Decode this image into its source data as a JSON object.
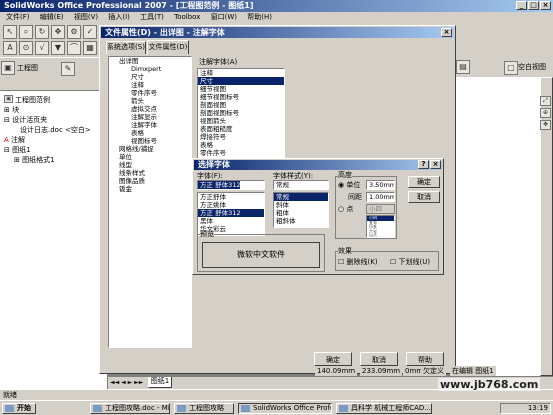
{
  "app": {
    "title": "SolidWorks Office Professional 2007 - [工程图范例 - 图纸1]"
  },
  "menu": [
    "文件(F)",
    "编辑(E)",
    "视图(V)",
    "插入(I)",
    "工具(T)",
    "Toolbox",
    "窗口(W)",
    "帮助(H)"
  ],
  "toolbar": {
    "labels": [
      "工程图",
      "草图",
      "注解",
      "空白视图"
    ]
  },
  "tree": {
    "items": [
      "工程图范例",
      "块",
      "设计活页夹",
      "设计日志.doc <空白>",
      "注解",
      "图纸1",
      "图纸格式1"
    ]
  },
  "doc_props": {
    "title": "文件属性(D) - 出详图 - 注解字体",
    "tabs": [
      "系统选项(S)",
      "文件属性(D)"
    ],
    "left_items": [
      "出详图",
      "Dimxpert",
      "尺寸",
      "注释",
      "零件序号",
      "箭头",
      "虚拟交点",
      "注解显示",
      "注解字体",
      "表格",
      "视图标号",
      "网格线/捕捉",
      "单位",
      "线型",
      "线条样式",
      "图像品质",
      "钣金"
    ],
    "font_label": "注解字体(A)",
    "font_items": [
      "注释",
      "尺寸",
      "细节视图",
      "细节视图标号",
      "剖面视图",
      "剖面视图标号",
      "视图箭头",
      "表面粗糙度",
      "焊接符号",
      "表格",
      "零件序号"
    ],
    "ok": "确定",
    "cancel": "取消",
    "help": "帮助"
  },
  "font_dialog": {
    "title": "选择字体",
    "font_label": "字体(F):",
    "font_value": "方正 舒体312",
    "font_items": [
      "方正舒体",
      "方正姚体",
      "方正 舒体312",
      "黑体",
      "华文彩云"
    ],
    "style_label": "字体样式(Y):",
    "style_value": "常规",
    "style_items": [
      "常规",
      "斜体",
      "粗体",
      "粗斜体"
    ],
    "height_group": "高度",
    "unit_label": "单位",
    "unit_value": "3.50mm",
    "spacing_label": "间距",
    "spacing_value": "1.00mm",
    "points_label": "点",
    "points_value": "小四",
    "points_items": [
      "小四",
      "五号",
      "小五",
      "六号",
      "小六"
    ],
    "ok": "确定",
    "cancel": "取消",
    "preview_label": "预览",
    "preview_text": "微软中文软件",
    "effects_label": "效果",
    "strike_label": "删除线(K)",
    "underline_label": "下划线(U)"
  },
  "sheet_tab": "图纸1",
  "status": {
    "left": "就绪",
    "coords": [
      "140.09mm",
      "233.09mm",
      "0mm"
    ],
    "mode": "欠定义",
    "editing": "在编辑 图纸1"
  },
  "taskbar": {
    "start": "开始",
    "items": [
      "工程图攻略.doc - Micro...",
      "工程图攻略",
      "SolidWorks Office Profes...",
      "具科学 机械工程师CAD..."
    ],
    "clock": "13:19"
  },
  "watermark": "www.jb768.com"
}
